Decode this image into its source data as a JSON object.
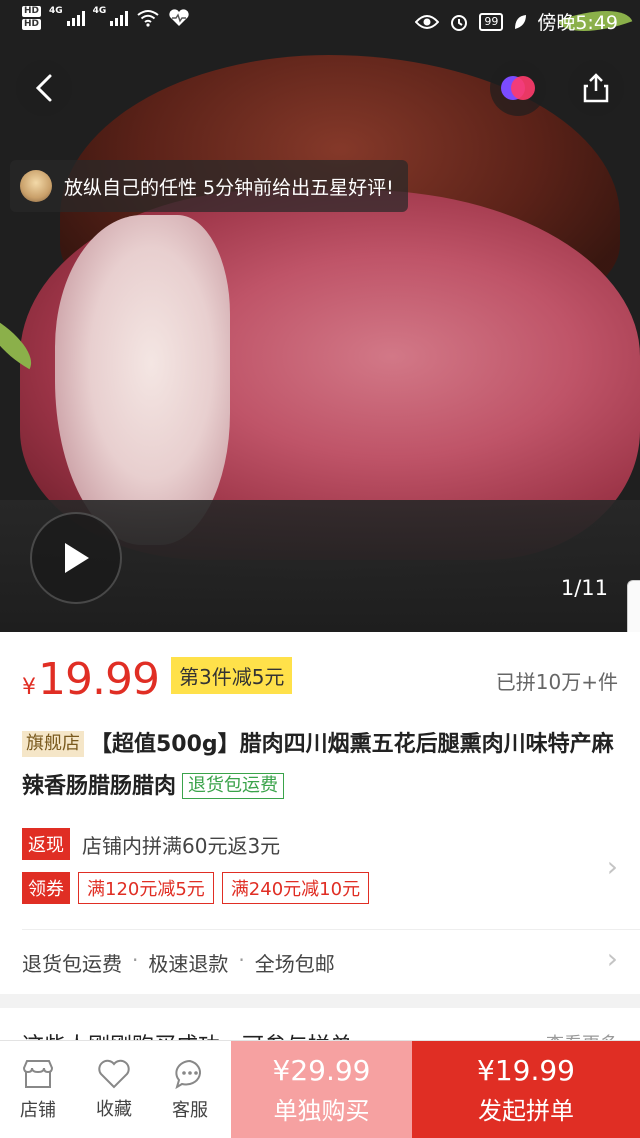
{
  "status_bar": {
    "hd1": "HD",
    "hd2": "HD",
    "net1": "4G",
    "net2": "4G",
    "battery": "99",
    "time": "傍晚5:49"
  },
  "hero": {
    "toast": "放纵自己的任性 5分钟前给出五星好评!",
    "image_counter": "1/11"
  },
  "product": {
    "currency": "¥",
    "price": "19.99",
    "promo_tag": "第3件减5元",
    "grouped_count": "已拼10万+件",
    "store_tag": "旗舰店",
    "title": "【超值500g】腊肉四川烟熏五花后腿熏肉川味特产麻辣香肠腊肠腊肉",
    "refund_tag": "退货包运费",
    "cashback_label": "返现",
    "cashback_text": "店铺内拼满60元返3元",
    "coupon_label": "领券",
    "coupons": [
      "满120元减5元",
      "满240元减10元"
    ],
    "services": [
      "退货包运费",
      "极速退款",
      "全场包邮"
    ],
    "service_sep": "·"
  },
  "next_section": {
    "title": "这些人刚刚购买成功，可参与拼单",
    "more": "查看更多"
  },
  "bottom_bar": {
    "store": "店铺",
    "favorite": "收藏",
    "service": "客服",
    "solo_price": "¥29.99",
    "solo_label": "单独购买",
    "group_price": "¥19.99",
    "group_label": "发起拼单"
  },
  "colors": {
    "accent_red": "#e02e24",
    "solo_pink": "#f6a1a1",
    "promo_yellow": "#ffe14a",
    "refund_green": "#3aa34a"
  }
}
